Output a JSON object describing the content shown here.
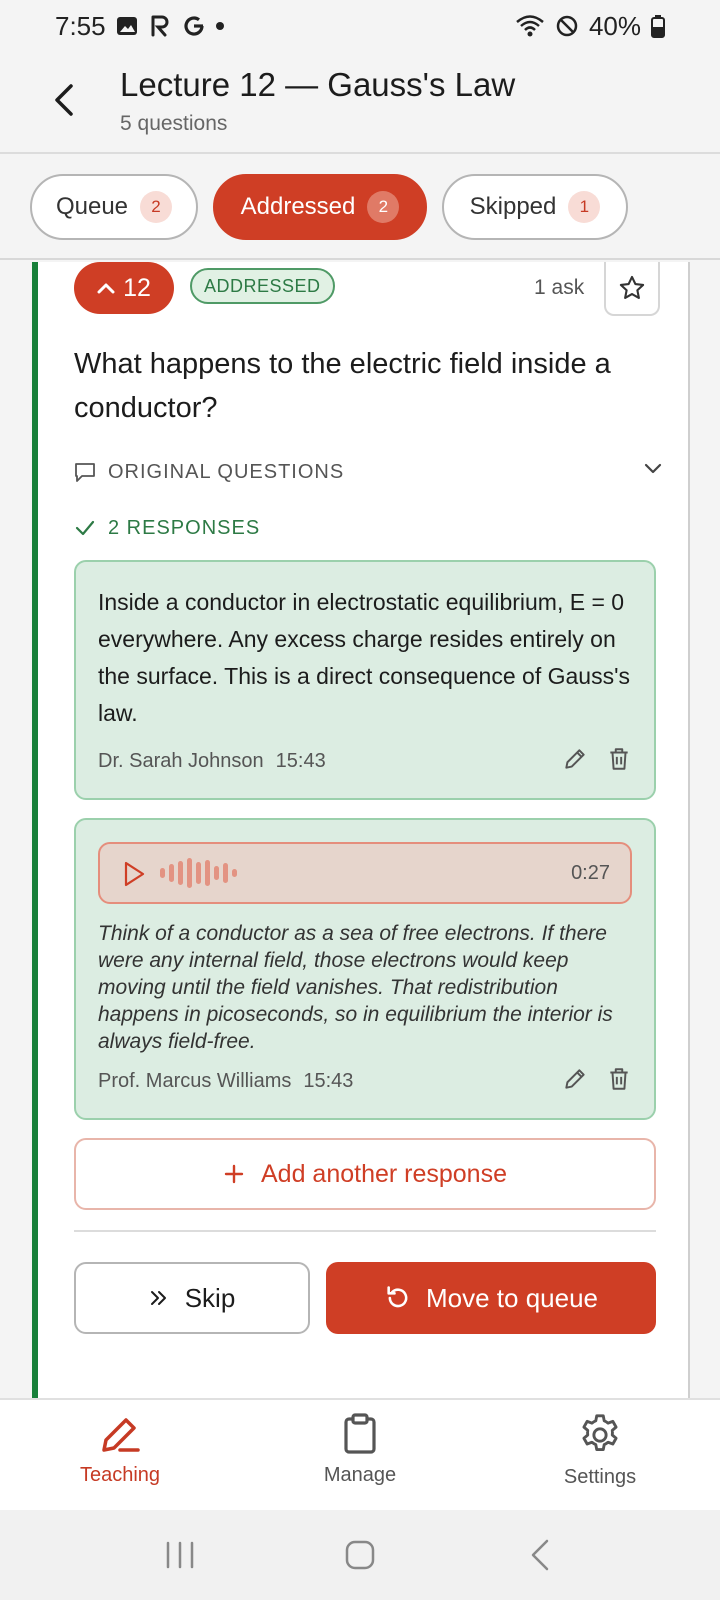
{
  "status_bar": {
    "time": "7:55",
    "battery": "40%",
    "icons": [
      "gallery-icon",
      "r-app-icon",
      "google-icon",
      "notification-dot",
      "wifi-icon",
      "do-not-disturb-icon",
      "battery-icon"
    ]
  },
  "header": {
    "title": "Lecture 12 — Gauss's Law",
    "subtitle": "5 questions"
  },
  "tabs": [
    {
      "label": "Queue",
      "count": "2"
    },
    {
      "label": "Addressed",
      "count": "2"
    },
    {
      "label": "Skipped",
      "count": "1"
    }
  ],
  "question": {
    "votes": "12",
    "status": "ADDRESSED",
    "ask_count": "1 ask",
    "text": "What happens to the electric field inside a conductor?",
    "original_label": "ORIGINAL QUESTIONS",
    "responses_label": "2 RESPONSES"
  },
  "responses": [
    {
      "text": "Inside a conductor in electrostatic equilibrium, E = 0 everywhere. Any excess charge resides entirely on the surface. This is a direct consequence of Gauss's law.",
      "author": "Dr. Sarah Johnson",
      "time": "15:43"
    },
    {
      "audio_duration": "0:27",
      "transcript": "Think of a conductor as a sea of free electrons. If there were any internal field, those electrons would keep moving until the field vanishes. That redistribution happens in picoseconds, so in equilibrium the interior is always field-free.",
      "author": "Prof. Marcus Williams",
      "time": "15:43"
    }
  ],
  "actions": {
    "add_response": "Add another response",
    "skip": "Skip",
    "move_to_queue": "Move to queue"
  },
  "bottom_nav": [
    {
      "label": "Teaching",
      "active": true
    },
    {
      "label": "Manage",
      "active": false
    },
    {
      "label": "Settings",
      "active": false
    }
  ],
  "colors": {
    "accent": "#cf3e25",
    "success": "#18803a",
    "response_bg": "#dcede2"
  }
}
